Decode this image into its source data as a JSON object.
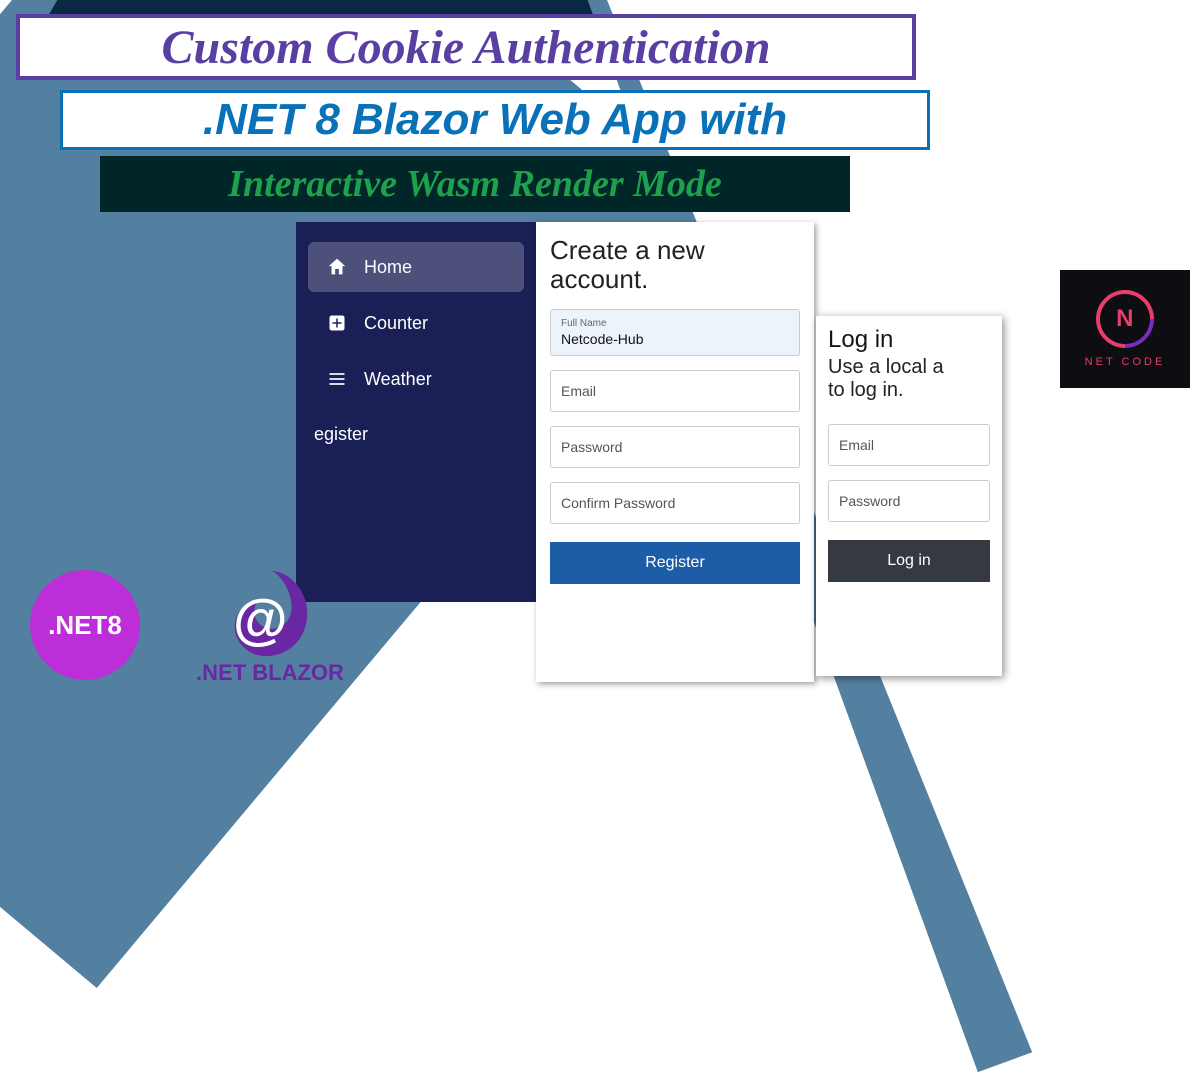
{
  "titles": {
    "line1": "Custom Cookie Authentication",
    "line2": ".NET 8 Blazor Web App with",
    "line3": "Interactive Wasm Render Mode"
  },
  "sidebar": {
    "items": [
      {
        "label": "Home"
      },
      {
        "label": "Counter"
      },
      {
        "label": "Weather"
      },
      {
        "label": "egister"
      }
    ]
  },
  "create_panel": {
    "heading": "Create a new account.",
    "fullname_label": "Full Name",
    "fullname_value": "Netcode-Hub",
    "email_label": "Email",
    "password_label": "Password",
    "confirm_label": "Confirm Password",
    "button": "Register"
  },
  "login_panel": {
    "heading": "Log in",
    "subheading": "Use a local a\nto log in.",
    "email_label": "Email",
    "password_label": "Password",
    "button": "Log in"
  },
  "badges": {
    "net8": ".NET8",
    "blazor": ".NET BLAZOR",
    "netcode": "NET CODE"
  }
}
